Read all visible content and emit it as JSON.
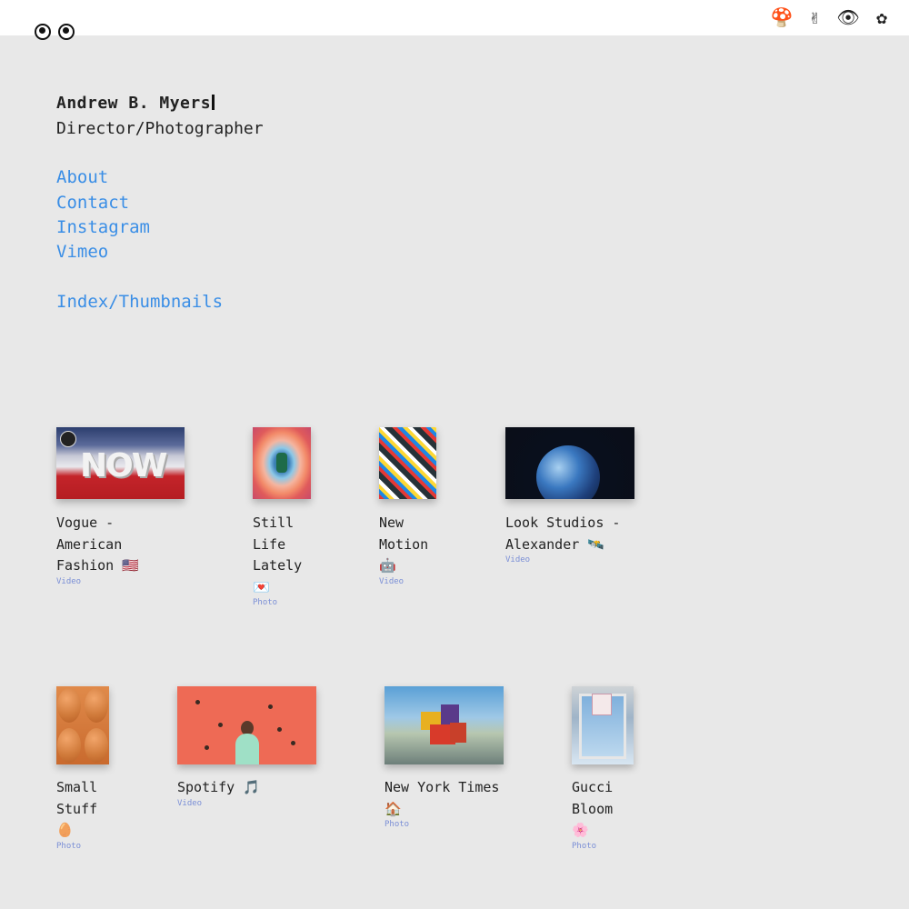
{
  "header": {
    "icons": [
      {
        "name": "mushroom-icon",
        "glyph": "🍄"
      },
      {
        "name": "peace-hand-icon",
        "glyph": "✌"
      },
      {
        "name": "eye-icon",
        "glyph": "👁"
      },
      {
        "name": "flower-icon",
        "glyph": "✿"
      }
    ]
  },
  "profile": {
    "name": "Andrew B. Myers",
    "role": "Director/Photographer"
  },
  "nav": {
    "about": "About",
    "contact": "Contact",
    "instagram": "Instagram",
    "vimeo": "Vimeo",
    "index": "Index/Thumbnails"
  },
  "projects": [
    {
      "title": "Vogue - American Fashion 🇺🇸",
      "type": "Video"
    },
    {
      "title": "Still Life Lately 💌",
      "type": "Photo"
    },
    {
      "title": "New Motion 🤖",
      "type": "Video"
    },
    {
      "title": "Look Studios - Alexander 🛰️",
      "type": "Video"
    },
    {
      "title": "Small Stuff 🥚",
      "type": "Photo"
    },
    {
      "title": "Spotify 🎵",
      "type": "Video"
    },
    {
      "title": "New York Times 🏠",
      "type": "Photo"
    },
    {
      "title": "Gucci Bloom 🌸",
      "type": "Photo"
    }
  ],
  "thumbnail_labels": {
    "vogue_text": "NOW"
  }
}
